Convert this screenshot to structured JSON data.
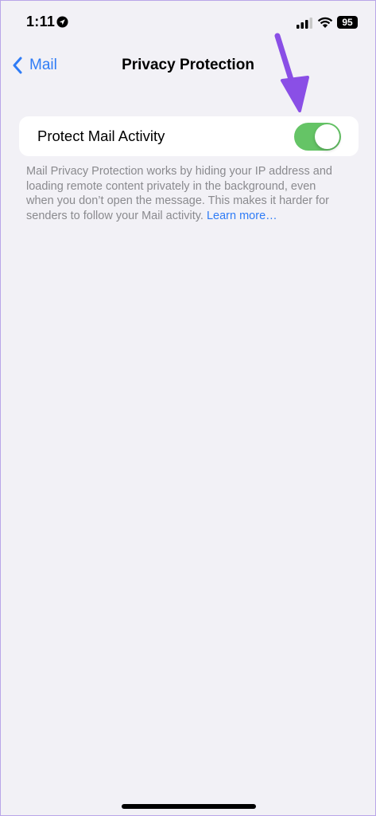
{
  "status_bar": {
    "time": "1:11",
    "battery": "95"
  },
  "nav": {
    "back_label": "Mail",
    "title": "Privacy Protection"
  },
  "setting": {
    "label": "Protect Mail Activity",
    "enabled": true,
    "toggle_color": "#65c466"
  },
  "footer": {
    "text": "Mail Privacy Protection works by hiding your IP address and loading remote content privately in the background, even when you don’t open the message. This makes it harder for senders to follow your Mail activity.",
    "link": "Learn more…"
  },
  "colors": {
    "background": "#f2f1f6",
    "accent": "#2f7cf6",
    "annotation_arrow": "#8a4fe6"
  }
}
